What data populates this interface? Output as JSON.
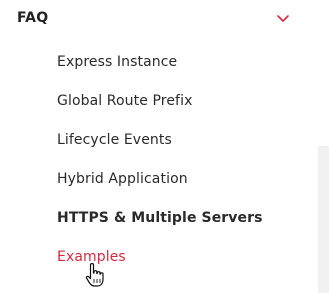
{
  "section": {
    "title": "FAQ",
    "expanded": true,
    "chevron_icon": "chevron-down-icon",
    "accent_color": "#d8293f"
  },
  "menu": {
    "items": [
      {
        "label": "Express Instance",
        "style": "normal"
      },
      {
        "label": "Global Route Prefix",
        "style": "normal"
      },
      {
        "label": "Lifecycle Events",
        "style": "normal"
      },
      {
        "label": "Hybrid Application",
        "style": "normal"
      },
      {
        "label": "HTTPS & Multiple Servers",
        "style": "bold"
      },
      {
        "label": "Examples",
        "style": "active"
      }
    ]
  },
  "pointer": {
    "icon": "hand-pointer-icon"
  }
}
